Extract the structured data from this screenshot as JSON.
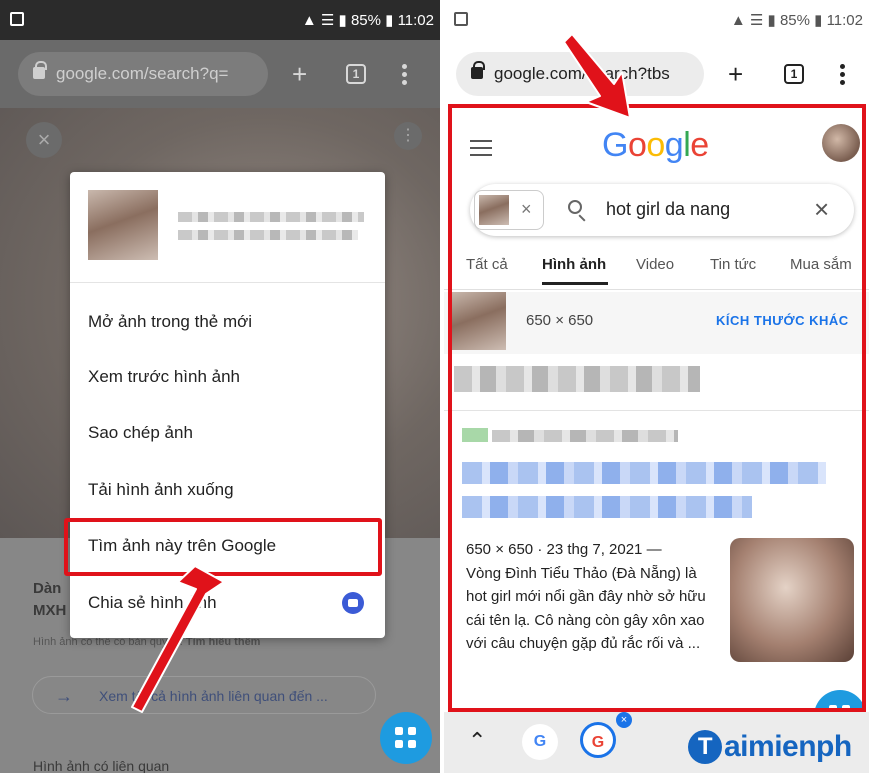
{
  "colors": {
    "accent_red": "#e0121a",
    "google_blue": "#1a73e8",
    "fab_blue": "#1e9be0"
  },
  "left_screen": {
    "status": {
      "battery": "85%",
      "time": "11:02"
    },
    "url": "google.com/search?q=",
    "tab_count": "1",
    "context_menu": {
      "items": [
        "Mở ảnh trong thẻ mới",
        "Xem trước hình ảnh",
        "Sao chép ảnh",
        "Tải hình ảnh xuống",
        "Tìm ảnh này trên Google",
        "Chia sẻ hình ảnh"
      ]
    },
    "background": {
      "title_line1": "Dàn",
      "title_line2": "MXH",
      "copyright_note": "Hình ảnh có thể có bản quyền.",
      "learn_more": "Tìm hiểu thêm",
      "see_all": "Xem tất cả hình ảnh liên quan đến ...",
      "related": "Hình ảnh có liên quan"
    }
  },
  "right_screen": {
    "status": {
      "battery": "85%",
      "time": "11:02"
    },
    "url": "google.com/search?tbs",
    "tab_count": "1",
    "logo": "Google",
    "search": {
      "query": "hot girl da nang"
    },
    "tabs": [
      "Tất cả",
      "Hình ảnh",
      "Video",
      "Tin tức",
      "Mua sắm"
    ],
    "active_tab": "Hình ảnh",
    "image_info": {
      "dimensions": "650 × 650",
      "other_sizes": "KÍCH THƯỚC KHÁC"
    },
    "result": {
      "meta": "650 × 650 · 23 thg 7, 2021 —",
      "snippet": "Vòng Đình Tiểu Thảo (Đà Nẵng) là hot girl mới nổi gần đây nhờ sở hữu cái tên lạ. Cô nàng còn gây xôn xao với câu chuyện gặp đủ rắc rối và ..."
    },
    "bottom": {
      "g_letter": "G",
      "close_glyph": "×"
    }
  },
  "watermark": {
    "initial": "T",
    "rest": "aimienph"
  }
}
